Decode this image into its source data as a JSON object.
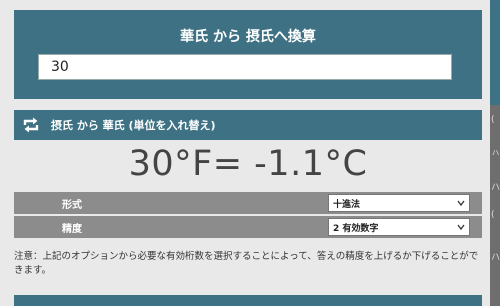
{
  "header": {
    "title": "華氏 から 摂氏へ換算",
    "input_value": "30"
  },
  "swap": {
    "label": "摂氏 から 華氏 (単位を入れ替え)",
    "icon": "swap-arrows-icon"
  },
  "result": {
    "text": "30°F= -1.1°C"
  },
  "options": [
    {
      "label": "形式",
      "selected": "十進法"
    },
    {
      "label": "精度",
      "selected": "2 有効数字"
    }
  ],
  "note": "注意：上記のオプションから必要な有効桁数を選択することによって、答えの精度を上げるか下げることができます。",
  "colors": {
    "panel": "#3d7183",
    "background": "#e9e9e9",
    "option_row": "#8c8c8c",
    "result_text": "#444444"
  }
}
